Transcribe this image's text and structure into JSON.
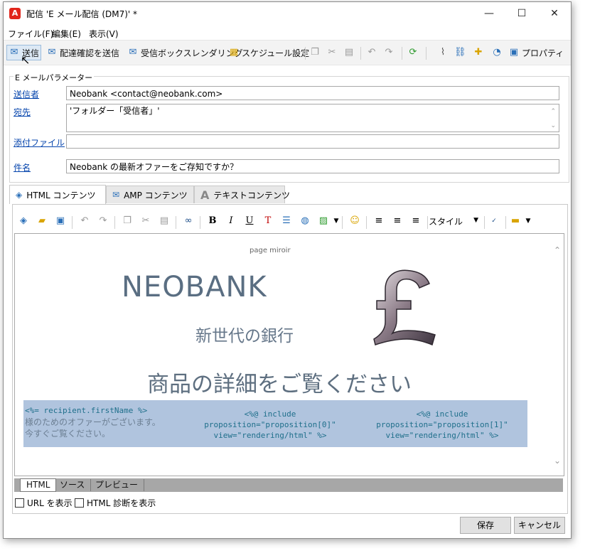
{
  "window": {
    "title": "配信 'E メール配信 (DM7)' *",
    "controls": {
      "minimize": "—",
      "maximize": "☐",
      "close": "✕"
    }
  },
  "menu": [
    "ファイル(F)",
    "編集(E)",
    "表示(V)"
  ],
  "toolbar": {
    "send": "送信",
    "send_proof": "配達確認を送信",
    "inbox_rendering": "受信ボックスレンダリング",
    "schedule": "スケジュール設定",
    "properties": "プロパティ"
  },
  "email_params": {
    "legend": "E メールパラメーター",
    "from_label": "送信者",
    "from_value": "Neobank <contact@neobank.com>",
    "to_label": "宛先",
    "to_value": "'フォルダー「受信者」'",
    "attachment_label": "添付ファイル",
    "attachment_value": "",
    "subject_label": "件名",
    "subject_value": "Neobank の最新オファーをご存知ですか？"
  },
  "content_tabs": [
    "HTML コンテンツ",
    "AMP コンテンツ",
    "テキストコンテンツ"
  ],
  "editor_toolbar": {
    "style_label": "スタイル"
  },
  "preview": {
    "page_miroir": "page miroir",
    "brand": "NEOBANK",
    "tagline": "新世代の銀行",
    "details": "商品の詳細をご覧ください",
    "recipient_code": "<%= recipient.firstName %>",
    "offer_line1": "様のためのオファーがございます。",
    "offer_line2": "今すぐご覧ください。",
    "include1": [
      "<%@ include",
      "proposition=\"proposition[0]\"",
      "view=\"rendering/html\" %>"
    ],
    "include2": [
      "<%@ include",
      "proposition=\"proposition[1]\"",
      "view=\"rendering/html\" %>"
    ]
  },
  "view_tabs": [
    "HTML",
    "ソース",
    "プレビュー"
  ],
  "options": {
    "show_url": "URL を表示",
    "show_html_diag": "HTML 診断を表示"
  },
  "buttons": {
    "save": "保存",
    "cancel": "キャンセル"
  },
  "colors": {
    "accent": "#0645ad",
    "band": "#b0c4de",
    "brand_text": "#5a6e82"
  }
}
